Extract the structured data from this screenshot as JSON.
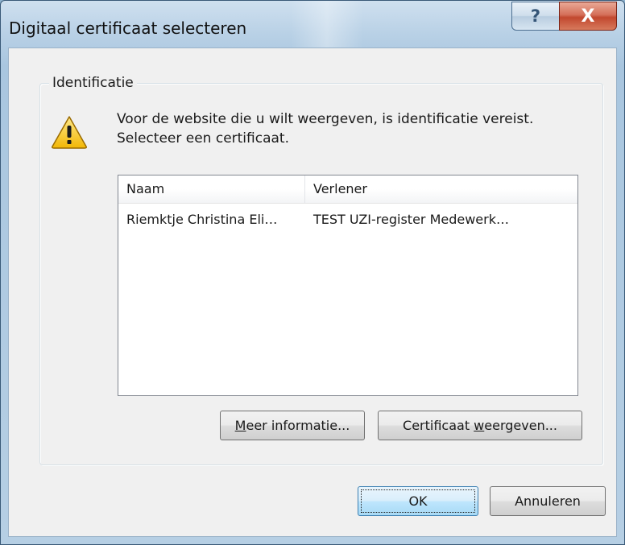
{
  "window": {
    "title": "Digitaal certificaat selecteren",
    "help_glyph": "?",
    "close_glyph": "X"
  },
  "group": {
    "label": "Identificatie"
  },
  "message": {
    "icon": "warning-icon",
    "text": "Voor de website die u wilt weergeven, is identificatie vereist. Selecteer een certificaat."
  },
  "certificates": {
    "columns": [
      "Naam",
      "Verlener"
    ],
    "rows": [
      {
        "naam": "Riemktje Christina Eli…",
        "verlener": "TEST UZI-register Medewerk…"
      }
    ]
  },
  "buttons": {
    "meer_informatie": {
      "underline": "M",
      "rest": "eer informatie..."
    },
    "certificaat_weergeven": {
      "prefix": "Certificaat ",
      "underline": "w",
      "rest": "eergeven..."
    },
    "ok": "OK",
    "annuleren": "Annuleren"
  },
  "colors": {
    "frame": "#b6cfe4",
    "close_button": "#c2482f",
    "client_bg": "#f0f0f0",
    "default_button_border": "#3c7fb1"
  }
}
